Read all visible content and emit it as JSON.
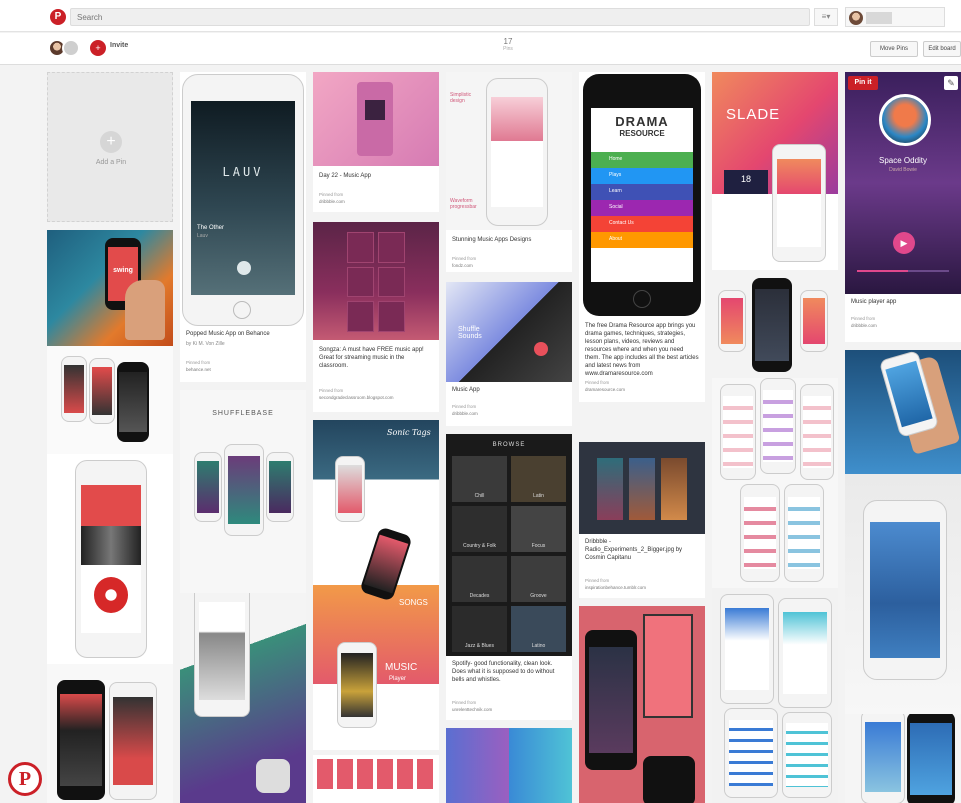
{
  "header": {
    "search_placeholder": "Search"
  },
  "board": {
    "invite_label": "Invite",
    "pin_count": "17",
    "pin_label": "Pins",
    "move_pins": "Move Pins",
    "edit_board": "Edit board"
  },
  "add_pin": {
    "label": "Add a Pin"
  },
  "pinned_from": "Pinned from",
  "pins": {
    "popped": {
      "desc": "Popped Music App on Behance",
      "by": "by Ki M. Von Zille",
      "domain": "behance.net",
      "artist": "LAUV",
      "song": "The Other",
      "artist_small": "Lauv"
    },
    "day22": {
      "desc": "Day 22 - Music App",
      "domain": "dribbble.com"
    },
    "songza": {
      "desc": "Songza: A must have FREE music app! Great for streaming music in the classroom.",
      "domain": "secondgradeclassroom.blogspot.com"
    },
    "stunning": {
      "desc": "Stunning Music Apps Designs",
      "domain": "fondz.com",
      "label_top": "Simplistic design",
      "label_bottom": "Waveform progressbar"
    },
    "musicapp": {
      "desc": "Music App",
      "domain": "dribbble.com",
      "screen_text": "Shuffle Sounds"
    },
    "spotify": {
      "desc": "Spotify- good functionality, clean look. Does what it is supposed to do without bells and whistles.",
      "domain": "unrelenttechnik.com",
      "browse": "BROWSE",
      "tiles": [
        "Chill",
        "Latin",
        "Country & Folk",
        "Focus",
        "Decades",
        "Groove",
        "Jazz & Blues",
        "Latino"
      ]
    },
    "drama": {
      "title": "DRAMA",
      "subtitle": "RESOURCE",
      "menu": [
        "Home",
        "Plays",
        "Learn",
        "Social",
        "Contact Us",
        "About"
      ],
      "desc": "The free Drama Resource app brings you drama games, techniques, strategies, lesson plans, videos, reviews and resources where and when you need them. The app includes all the best articles and latest news from www.dramaresource.com",
      "domain": "dramaresource.com"
    },
    "dribbble": {
      "desc": "Dribbble - Radio_Experiments_2_Bigger.jpg by Cosmin Capitanu",
      "domain": "inspirationbehance.tumblr.com"
    },
    "slade": {
      "title": "SLADE",
      "num": "18"
    },
    "player": {
      "desc": "Music player app",
      "domain": "dribbble.com",
      "artist": "Space Oddity",
      "song": "David Bowie"
    },
    "shuffle": {
      "brand": "SHUFFLEBASE"
    },
    "swing": {
      "brand": "swing"
    },
    "songs": {
      "a": "SONGS",
      "b": "MUSIC",
      "c": "Player",
      "script": "Sonic Tags"
    }
  },
  "pinit_label": "Pin it",
  "colors": {
    "accent": "#cb2027"
  }
}
